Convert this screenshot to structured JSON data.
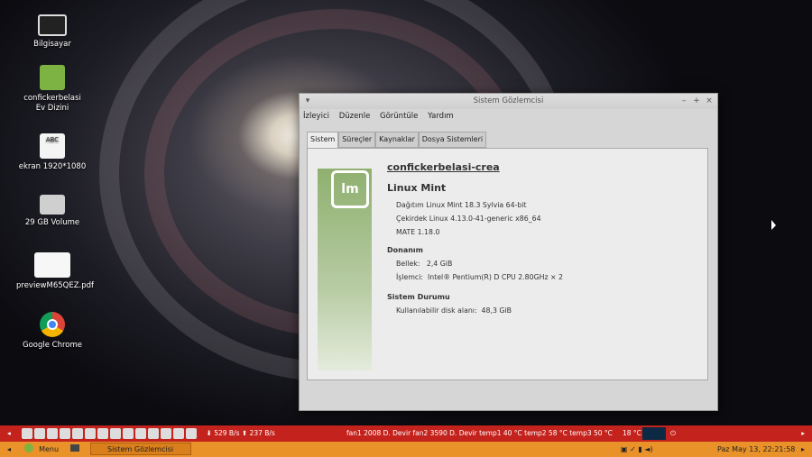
{
  "desktop": {
    "icons": [
      {
        "label": "Bilgisayar",
        "icon": "computer-icon"
      },
      {
        "label": "confickerbelasi Ev Dizini",
        "icon": "home-folder-icon"
      },
      {
        "label": "ekran 1920*1080",
        "icon": "text-file-icon"
      },
      {
        "label": "29 GB Volume",
        "icon": "drive-icon"
      },
      {
        "label": "previewM65QEZ.pdf",
        "icon": "pdf-file-icon"
      },
      {
        "label": "Google Chrome",
        "icon": "chrome-icon"
      }
    ]
  },
  "window": {
    "title": "Sistem Gözlemcisi",
    "menu": [
      "İzleyici",
      "Düzenle",
      "Görüntüle",
      "Yardım"
    ],
    "tabs": [
      "Sistem",
      "Süreçler",
      "Kaynaklar",
      "Dosya Sistemleri"
    ],
    "logo_text": "lm",
    "hostname": "confickerbelasi-crea",
    "os_name": "Linux Mint",
    "os_lines": [
      "Dağıtım Linux Mint 18.3 Sylvia 64-bit",
      "Çekirdek Linux 4.13.0-41-generic x86_64",
      "MATE 1.18.0"
    ],
    "hardware_title": "Donanım",
    "hardware_lines": [
      "Bellek:   2,4 GiB",
      "İşlemci:  Intel® Pentium(R) D CPU 2.80GHz × 2"
    ],
    "status_title": "Sistem Durumu",
    "status_lines": [
      "Kullanılabilir disk alanı:  48,3 GiB"
    ]
  },
  "top_panel": {
    "net": "⬇ 529 B/s  ⬆ 237 B/s",
    "sensors": "fan1 2008 D. Devir fan2 3590 D. Devir temp1 40 °C temp2 58 °C temp3 50 °C",
    "temp": "18 °C"
  },
  "bottom_panel": {
    "menu_label": "Menu",
    "task_label": "Sistem Gözlemcisi",
    "clock": "Paz May 13, 22:21:58"
  }
}
